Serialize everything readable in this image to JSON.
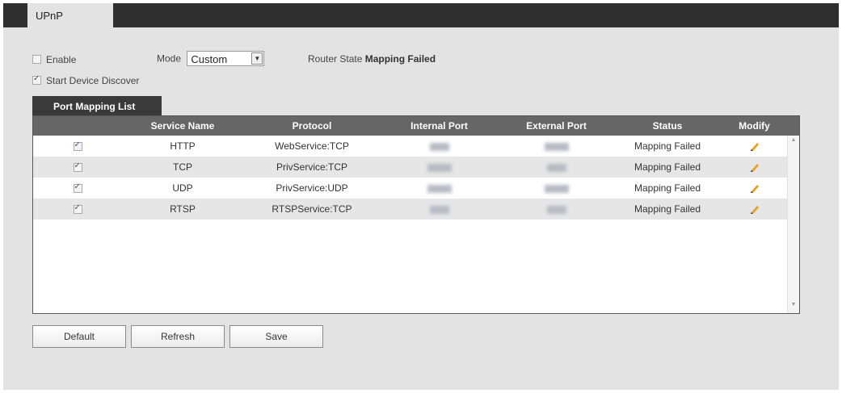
{
  "tabs": {
    "active_label": "UPnP"
  },
  "settings": {
    "enable_label": "Enable",
    "enable_checked": false,
    "mode_label": "Mode",
    "mode_value": "Custom",
    "router_state_label": "Router State",
    "router_state_value": "Mapping Failed",
    "discover_label": "Start Device Discover",
    "discover_checked": true
  },
  "port_mapping": {
    "tab_label": "Port Mapping List",
    "headers": {
      "service_name": "Service Name",
      "protocol": "Protocol",
      "internal_port": "Internal Port",
      "external_port": "External Port",
      "status": "Status",
      "modify": "Modify"
    },
    "rows": [
      {
        "checked": true,
        "service_name": "HTTP",
        "protocol": "WebService:TCP",
        "status": "Mapping Failed"
      },
      {
        "checked": true,
        "service_name": "TCP",
        "protocol": "PrivService:TCP",
        "status": "Mapping Failed"
      },
      {
        "checked": true,
        "service_name": "UDP",
        "protocol": "PrivService:UDP",
        "status": "Mapping Failed"
      },
      {
        "checked": true,
        "service_name": "RTSP",
        "protocol": "RTSPService:TCP",
        "status": "Mapping Failed"
      }
    ]
  },
  "buttons": {
    "default_label": "Default",
    "refresh_label": "Refresh",
    "save_label": "Save"
  },
  "icons": {
    "modify": "pencil-icon"
  },
  "colors": {
    "tab_bar": "#2f2f2f",
    "table_header": "#666666",
    "background": "#e3e3e3"
  }
}
